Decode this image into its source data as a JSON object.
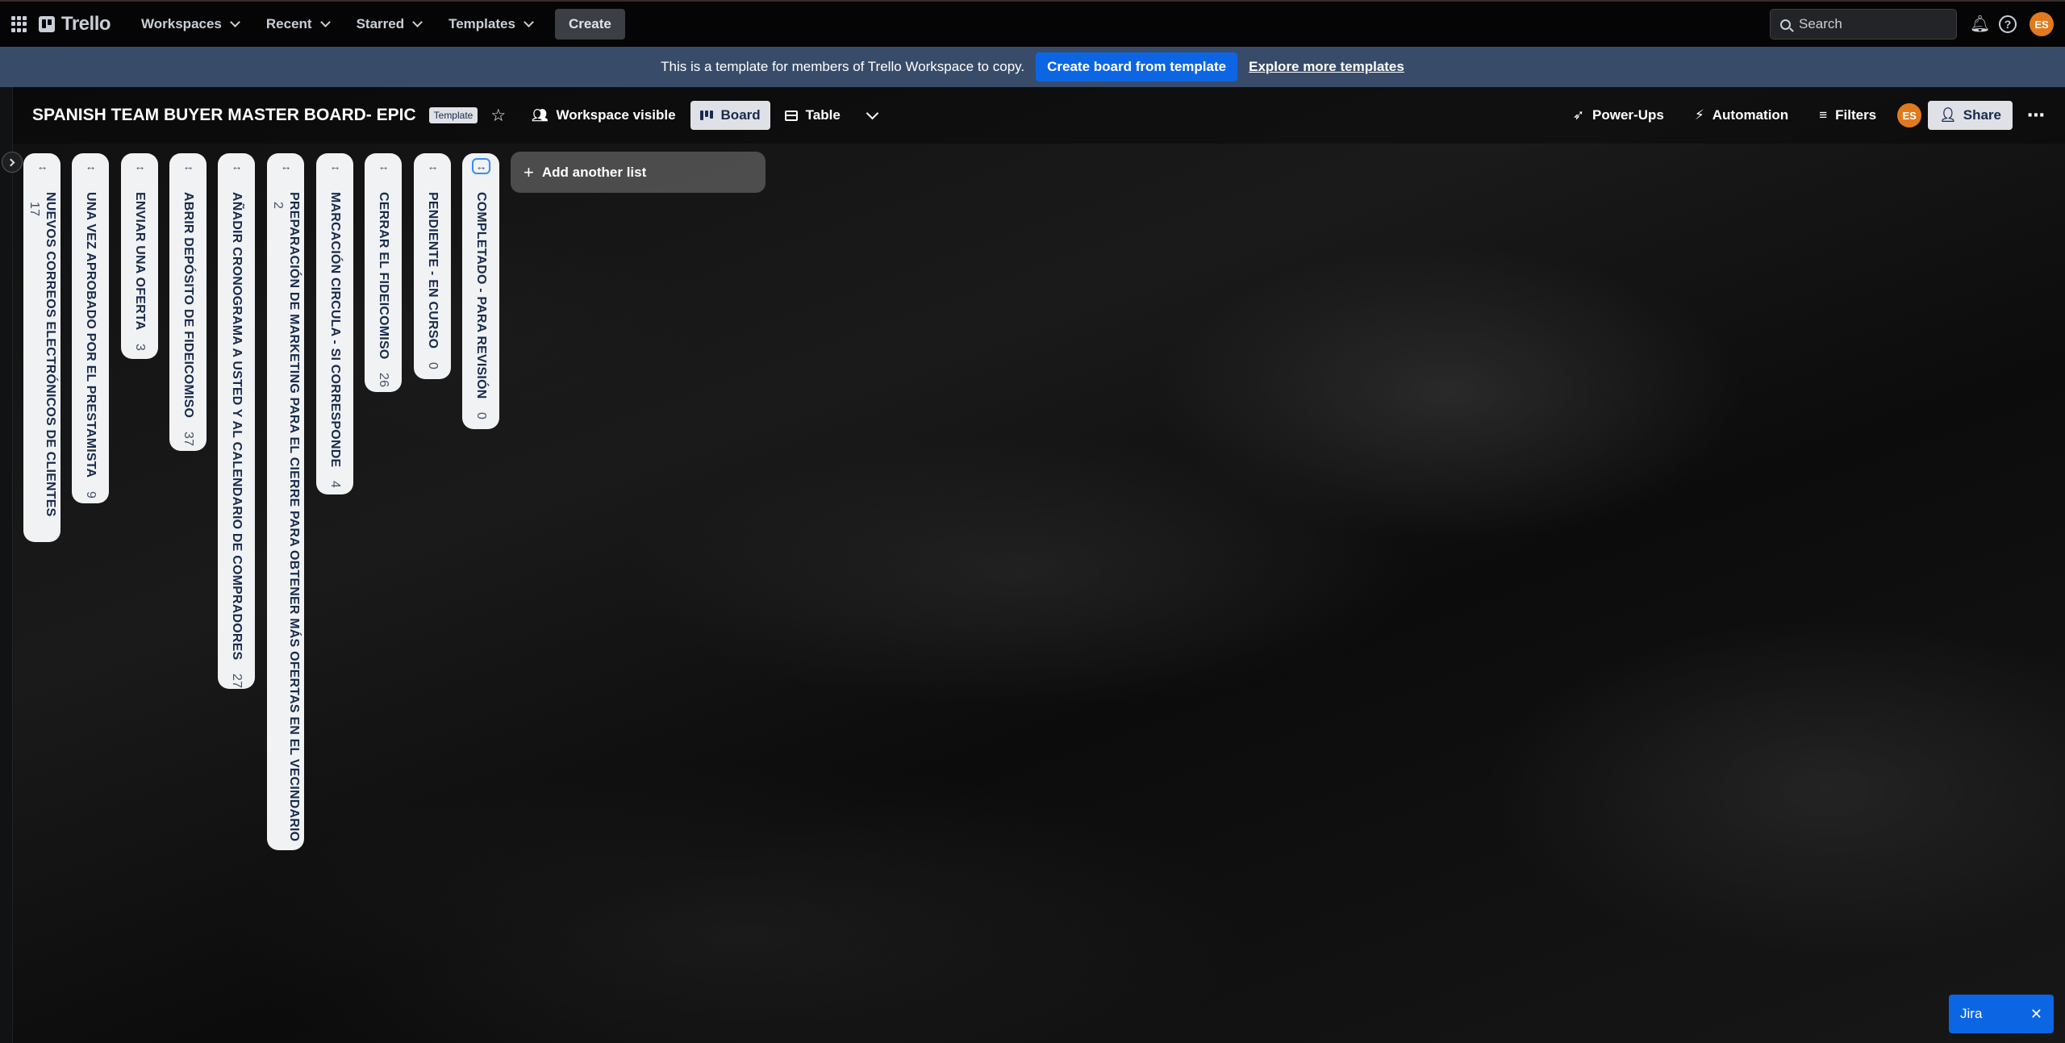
{
  "topnav": {
    "logo": "Trello",
    "menus": [
      "Workspaces",
      "Recent",
      "Starred",
      "Templates"
    ],
    "create_label": "Create",
    "search_placeholder": "Search",
    "avatar_initials": "ES"
  },
  "banner": {
    "text": "This is a template for members of Trello Workspace to copy.",
    "create_button": "Create board from template",
    "explore_link": "Explore more templates"
  },
  "board": {
    "title": "SPANISH TEAM BUYER MASTER BOARD- EPIC",
    "badge": "Template",
    "visibility": "Workspace visible",
    "views": [
      "Board",
      "Table"
    ],
    "power_ups": "Power-Ups",
    "automation": "Automation",
    "filters": "Filters",
    "member_initials": "ES",
    "share": "Share"
  },
  "lists": [
    {
      "title": "NUEVOS CORREOS ELECTRÓNICOS DE CLIENTES",
      "count": "17"
    },
    {
      "title": "UNA VEZ APROBADO POR EL PRESTAMISTA",
      "count": "9"
    },
    {
      "title": "ENVIAR UNA OFERTA",
      "count": "3"
    },
    {
      "title": "ABRIR DEPÓSITO DE FIDEICOMISO",
      "count": "37"
    },
    {
      "title": "AÑADIR CRONOGRAMA A USTED Y AL CALENDARIO DE COMPRADORES",
      "count": "27"
    },
    {
      "title": "PREPARACIÓN DE MARKETING PARA EL CIERRE PARA OBTENER MÁS OFERTAS EN EL VECINDARIO",
      "count": "2"
    },
    {
      "title": "MARCACIÓN CIRCULA - SI CORRESPONDE",
      "count": "4"
    },
    {
      "title": "CERRAR EL FIDEICOMISO",
      "count": "26"
    },
    {
      "title": "PENDIENTE - EN CURSO",
      "count": "0"
    },
    {
      "title": "COMPLETADO - PARA REVISIÓN",
      "count": "0"
    }
  ],
  "add_list_label": "Add another list",
  "jira": {
    "label": "Jira",
    "close": "✕"
  },
  "colors": {
    "banner": "#384c69",
    "primary": "#0c66e4",
    "avatar": "#e07a1f",
    "list_bg": "#f1f2f4"
  }
}
